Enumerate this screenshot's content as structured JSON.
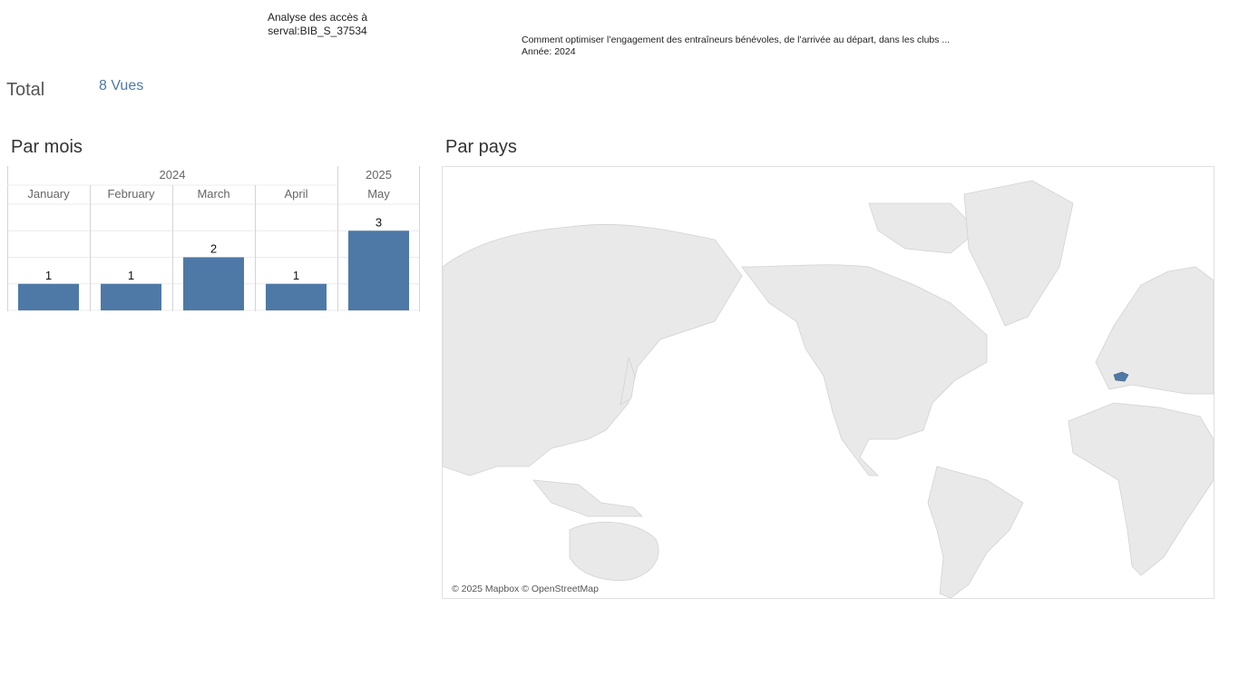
{
  "header": {
    "title_line1": "Analyse des accès à",
    "title_line2": "serval:BIB_S_37534",
    "description": "Comment optimiser l’engagement des entraîneurs bénévoles, de l’arrivée au départ, dans les clubs ...",
    "year_line": "Année: 2024"
  },
  "total": {
    "label": "Total",
    "value": "8 Vues"
  },
  "sections": {
    "by_month": "Par mois",
    "by_country": "Par pays"
  },
  "colors": {
    "bar": "#4e79a7",
    "land": "#e9e9e9",
    "highlight_country": "#4e79a7",
    "text_blue": "#4e79a7"
  },
  "chart_data": {
    "type": "bar",
    "year_groups": [
      {
        "label": "2024",
        "months": [
          "January",
          "February",
          "March",
          "April"
        ]
      },
      {
        "label": "2025",
        "months": [
          "May"
        ]
      }
    ],
    "categories": [
      "January",
      "February",
      "March",
      "April",
      "May"
    ],
    "values": [
      1,
      1,
      2,
      1,
      3
    ],
    "data_labels": [
      "1",
      "1",
      "2",
      "1",
      "3"
    ],
    "ylim": [
      0,
      3
    ],
    "grid": true,
    "title": "",
    "xlabel": "",
    "ylabel": ""
  },
  "map": {
    "highlighted_country": "Switzerland",
    "attribution": "© 2025 Mapbox © OpenStreetMap"
  }
}
